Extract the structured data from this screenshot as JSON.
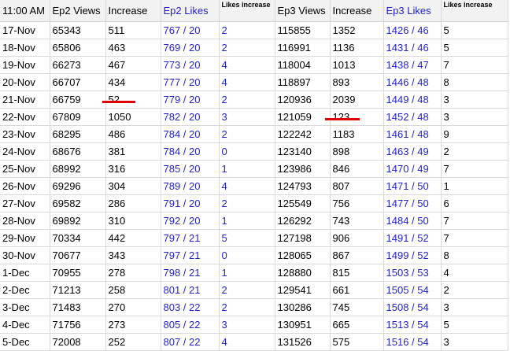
{
  "header": {
    "time": "11:00 AM",
    "ep2_views": "Ep2 Views",
    "increase1": "Increase",
    "ep2_likes": "Ep2 Likes",
    "likes_increase1": "Likes increase",
    "ep3_views": "Ep3 Views",
    "increase2": "Increase",
    "ep3_likes": "Ep3 Likes",
    "likes_increase2": "Likes increase"
  },
  "rows": [
    [
      "17-Nov",
      "65343",
      "511",
      "767 / 20",
      "2",
      "115855",
      "1352",
      "1426 / 46",
      "5"
    ],
    [
      "18-Nov",
      "65806",
      "463",
      "769 / 20",
      "2",
      "116991",
      "1136",
      "1431 / 46",
      "5"
    ],
    [
      "19-Nov",
      "66273",
      "467",
      "773 / 20",
      "4",
      "118004",
      "1013",
      "1438 / 47",
      "7"
    ],
    [
      "20-Nov",
      "66707",
      "434",
      "777 / 20",
      "4",
      "118897",
      "893",
      "1446 / 48",
      "8"
    ],
    [
      "21-Nov",
      "66759",
      "52",
      "779 / 20",
      "2",
      "120936",
      "2039",
      "1449 / 48",
      "3"
    ],
    [
      "22-Nov",
      "67809",
      "1050",
      "782 / 20",
      "3",
      "121059",
      "123",
      "1452 / 48",
      "3"
    ],
    [
      "23-Nov",
      "68295",
      "486",
      "784 / 20",
      "2",
      "122242",
      "1183",
      "1461 / 48",
      "9"
    ],
    [
      "24-Nov",
      "68676",
      "381",
      "784 / 20",
      "0",
      "123140",
      "898",
      "1463 / 49",
      "2"
    ],
    [
      "25-Nov",
      "68992",
      "316",
      "785 / 20",
      "1",
      "123986",
      "846",
      "1470 / 49",
      "7"
    ],
    [
      "26-Nov",
      "69296",
      "304",
      "789 / 20",
      "4",
      "124793",
      "807",
      "1471 / 50",
      "1"
    ],
    [
      "27-Nov",
      "69582",
      "286",
      "791 / 20",
      "2",
      "125549",
      "756",
      "1477 / 50",
      "6"
    ],
    [
      "28-Nov",
      "69892",
      "310",
      "792 / 20",
      "1",
      "126292",
      "743",
      "1484 / 50",
      "7"
    ],
    [
      "29-Nov",
      "70334",
      "442",
      "797 / 21",
      "5",
      "127198",
      "906",
      "1491 / 52",
      "7"
    ],
    [
      "30-Nov",
      "70677",
      "343",
      "797 / 21",
      "0",
      "128065",
      "867",
      "1499 / 52",
      "8"
    ],
    [
      "1-Dec",
      "70955",
      "278",
      "798 / 21",
      "1",
      "128880",
      "815",
      "1503 / 53",
      "4"
    ],
    [
      "2-Dec",
      "71213",
      "258",
      "801 / 21",
      "2",
      "129541",
      "661",
      "1505 / 54",
      "2"
    ],
    [
      "3-Dec",
      "71483",
      "270",
      "803 / 22",
      "2",
      "130286",
      "745",
      "1508 / 54",
      "3"
    ],
    [
      "4-Dec",
      "71756",
      "273",
      "805 / 22",
      "3",
      "130951",
      "665",
      "1513 / 54",
      "5"
    ],
    [
      "5-Dec",
      "72008",
      "252",
      "807 / 22",
      "4",
      "131526",
      "575",
      "1516 / 54",
      "3"
    ]
  ],
  "colors": {
    "likes_blue": "#2323cc",
    "highlight_red": "#e00000"
  }
}
